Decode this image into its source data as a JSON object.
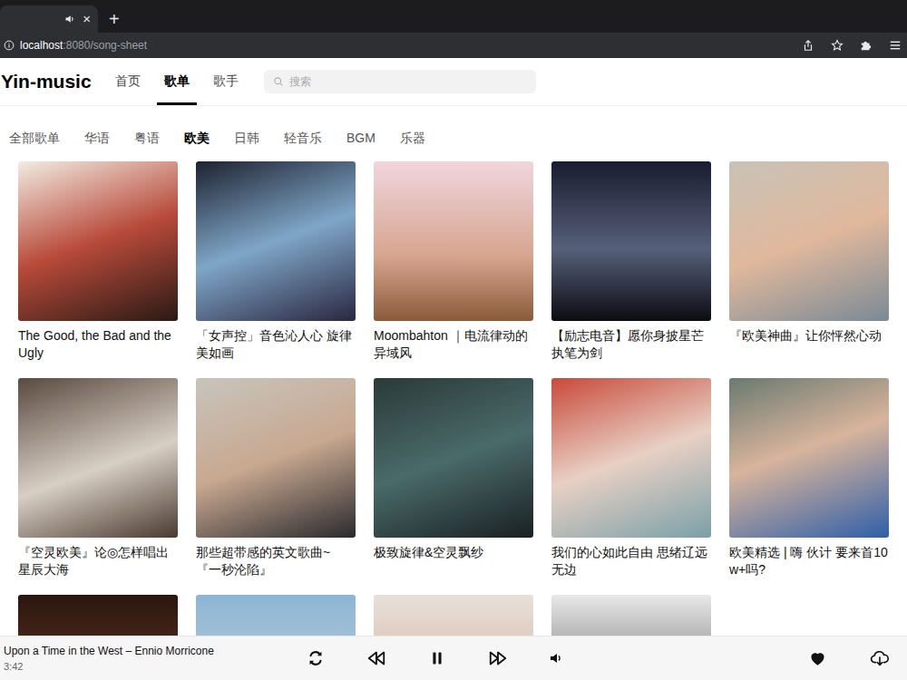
{
  "browser": {
    "tab": {
      "close": "×"
    },
    "new_tab": "+",
    "address": {
      "host": "localhost",
      "path": ":8080/song-sheet"
    }
  },
  "header": {
    "logo": "Yin-music",
    "nav": [
      {
        "label": "首页",
        "selected": false
      },
      {
        "label": "歌单",
        "selected": true
      },
      {
        "label": "歌手",
        "selected": false
      }
    ],
    "search": {
      "placeholder": "搜索"
    }
  },
  "categories": [
    {
      "label": "全部歌单",
      "selected": false
    },
    {
      "label": "华语",
      "selected": false
    },
    {
      "label": "粤语",
      "selected": false
    },
    {
      "label": "欧美",
      "selected": true
    },
    {
      "label": "日韩",
      "selected": false
    },
    {
      "label": "轻音乐",
      "selected": false
    },
    {
      "label": "BGM",
      "selected": false
    },
    {
      "label": "乐器",
      "selected": false
    }
  ],
  "playlists": [
    {
      "title": "The Good, the Bad and the Ugly"
    },
    {
      "title": "「女声控」音色沁人心 旋律美如画"
    },
    {
      "title": "Moombahton ｜电流律动的异域风"
    },
    {
      "title": "【励志电音】愿你身披星芒 执笔为剑"
    },
    {
      "title": "『欧美神曲』让你怦然心动"
    },
    {
      "title": "『空灵欧美』论◎怎样唱出星辰大海"
    },
    {
      "title": "那些超带感的英文歌曲~『一秒沦陷』"
    },
    {
      "title": "极致旋律&空灵飘纱"
    },
    {
      "title": "我们的心如此自由 思绪辽远无边"
    },
    {
      "title": "欧美精选 | 嗨 伙计 要来首10w+吗?"
    },
    {},
    {},
    {},
    {}
  ],
  "player": {
    "song": "Upon a Time in the West – Ennio Morricone",
    "time": "3:42",
    "playing": true,
    "liked": true
  }
}
